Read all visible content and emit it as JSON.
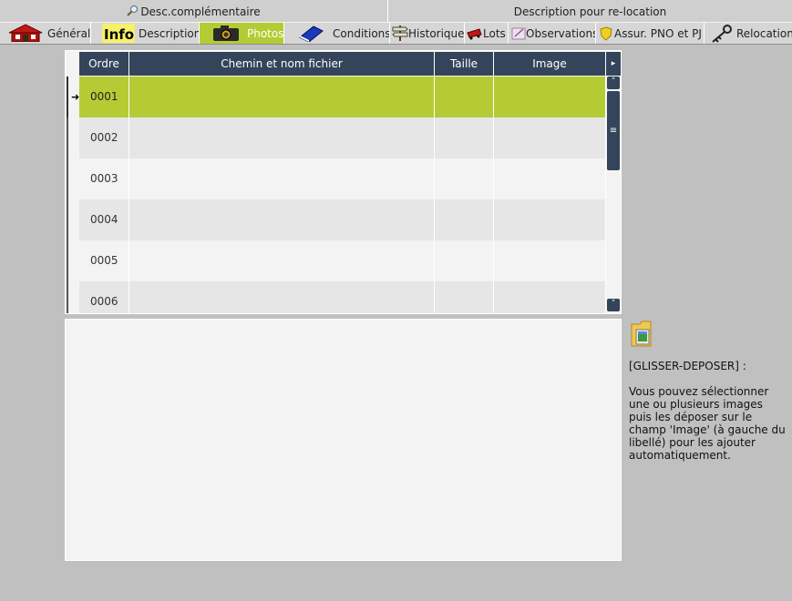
{
  "subtabs": [
    {
      "label": "Desc.complémentaire",
      "icon": "magnifier-icon"
    },
    {
      "label": "Description pour re-location"
    }
  ],
  "tabs": [
    {
      "label": "Général",
      "icon": "house-icon"
    },
    {
      "label": "Description",
      "icon": "info-icon"
    },
    {
      "label": "Photos",
      "icon": "camera-icon",
      "active": true
    },
    {
      "label": "Conditions",
      "icon": "book-icon"
    },
    {
      "label": "Historique",
      "icon": "signpost-icon"
    },
    {
      "label": "Lots",
      "icon": "cart-icon"
    },
    {
      "label": "Observations",
      "icon": "note-icon"
    },
    {
      "label": "Assur. PNO et PJ",
      "icon": "shield-icon"
    },
    {
      "label": "Relocation",
      "icon": "keys-icon"
    }
  ],
  "grid": {
    "columns": [
      "Ordre",
      "Chemin et nom fichier",
      "Taille",
      "Image"
    ],
    "rows": [
      {
        "ordre": "0001",
        "chemin": "",
        "taille": "",
        "image": ""
      },
      {
        "ordre": "0002",
        "chemin": "",
        "taille": "",
        "image": ""
      },
      {
        "ordre": "0003",
        "chemin": "",
        "taille": "",
        "image": ""
      },
      {
        "ordre": "0004",
        "chemin": "",
        "taille": "",
        "image": ""
      },
      {
        "ordre": "0005",
        "chemin": "",
        "taille": "",
        "image": ""
      },
      {
        "ordre": "0006",
        "chemin": "",
        "taille": "",
        "image": ""
      }
    ],
    "selected_row": "0001"
  },
  "help": {
    "title": "[GLISSER-DEPOSER] :",
    "text": "Vous pouvez sélectionner une ou plusieurs images puis les déposer sur le champ 'Image' (à gauche du libellé) pour les ajouter automatiquement."
  },
  "colors": {
    "accent": "#b5cb34",
    "header": "#34445a",
    "background": "#c0c0c0"
  }
}
